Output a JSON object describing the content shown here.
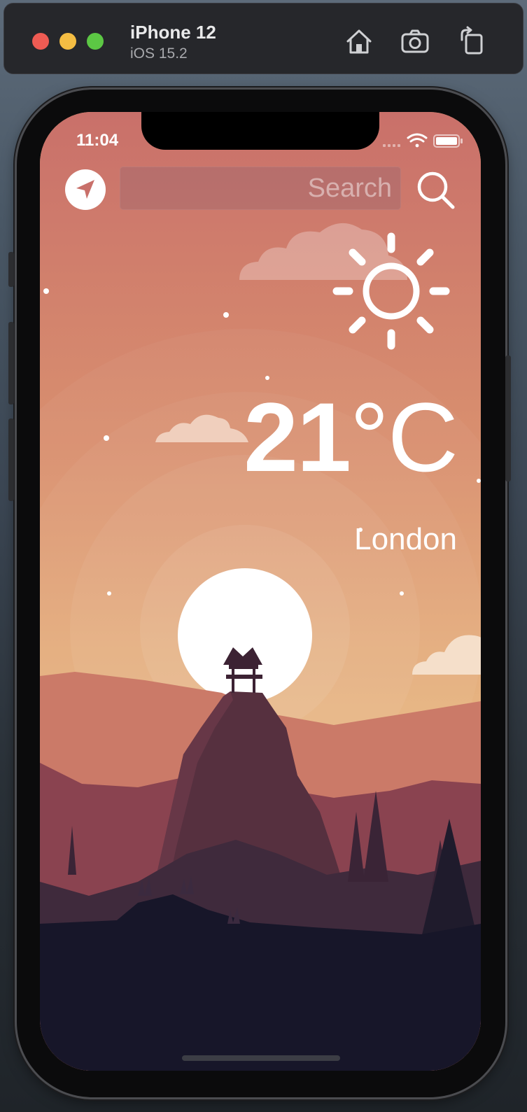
{
  "simulator": {
    "device_name": "iPhone 12",
    "os_version": "iOS 15.2",
    "toolbar_icons": [
      "home-icon",
      "screenshot-icon",
      "rotate-icon"
    ]
  },
  "status_bar": {
    "time": "11:04",
    "icons": [
      "cellular-signal-icon",
      "wifi-icon",
      "battery-icon"
    ]
  },
  "app": {
    "location_button_icon": "location-arrow-icon",
    "search": {
      "placeholder": "Search",
      "value": ""
    },
    "search_button_icon": "search-icon",
    "condition_icon": "sun-icon",
    "temperature_value": "21",
    "temperature_unit": "°C",
    "city": "London"
  },
  "colors": {
    "sky_top": "#c9706a",
    "sky_bottom": "#e8b87a",
    "sun_disc": "#ffffff",
    "ground": "#171629"
  }
}
